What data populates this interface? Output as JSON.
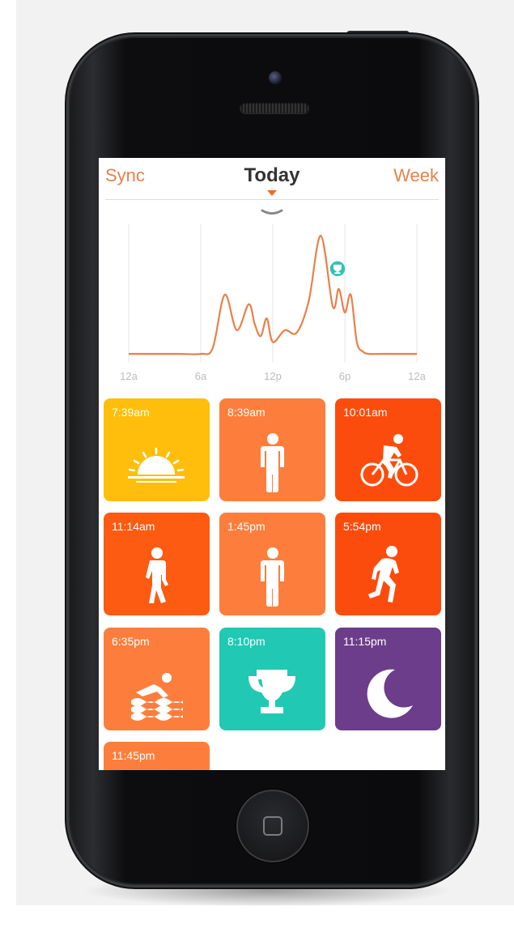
{
  "nav": {
    "left": "Sync",
    "title": "Today",
    "right": "Week"
  },
  "chart_data": {
    "type": "line",
    "x_ticks": [
      "12a",
      "6a",
      "12p",
      "6p",
      "12a"
    ],
    "x": [
      0,
      4,
      6,
      7,
      8,
      9,
      10,
      10.5,
      11,
      11.5,
      12,
      13,
      14,
      15,
      16,
      17,
      17.5,
      18,
      18.5,
      19,
      19.5,
      20,
      21,
      22,
      24
    ],
    "y": [
      0,
      0,
      0,
      0.05,
      0.5,
      0.2,
      0.42,
      0.25,
      0.15,
      0.3,
      0.1,
      0.2,
      0.18,
      0.45,
      1.0,
      0.4,
      0.55,
      0.35,
      0.5,
      0.1,
      0.02,
      0,
      0,
      0,
      0
    ],
    "colors": {
      "line": "#e8804a",
      "grid": "#e6e6e6",
      "marker": "#2ec4b6"
    },
    "marker": {
      "icon": "trophy-icon",
      "x": 18
    },
    "grid": true
  },
  "tiles": [
    {
      "time": "7:39am",
      "color": "#ffbe0b",
      "icon": "sunrise-icon"
    },
    {
      "time": "8:39am",
      "color": "#fd7e3c",
      "icon": "standing-person-icon"
    },
    {
      "time": "10:01am",
      "color": "#fc4c0d",
      "icon": "cyclist-icon"
    },
    {
      "time": "11:14am",
      "color": "#fd5a12",
      "icon": "walking-person-icon"
    },
    {
      "time": "1:45pm",
      "color": "#fd7e3c",
      "icon": "standing-person-icon"
    },
    {
      "time": "5:54pm",
      "color": "#fc4c0d",
      "icon": "running-person-icon"
    },
    {
      "time": "6:35pm",
      "color": "#fd7e3c",
      "icon": "swimmer-icon"
    },
    {
      "time": "8:10pm",
      "color": "#21c8b3",
      "icon": "trophy-icon"
    },
    {
      "time": "11:15pm",
      "color": "#6c3d8a",
      "icon": "moon-icon"
    },
    {
      "time": "11:45pm",
      "color": "#fd7e3c",
      "icon": ""
    }
  ]
}
